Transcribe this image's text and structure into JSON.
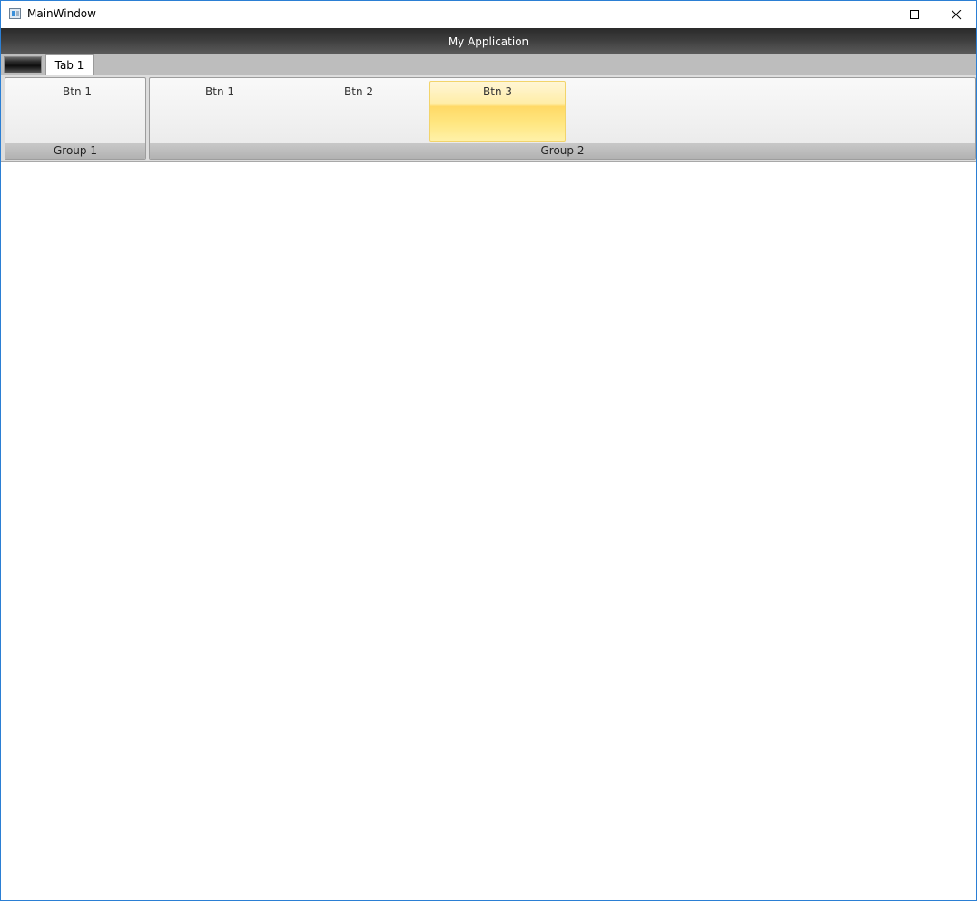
{
  "window": {
    "title": "MainWindow"
  },
  "app_header": {
    "title": "My Application"
  },
  "tabs": [
    {
      "label": "Tab 1",
      "selected": true
    }
  ],
  "ribbon": {
    "groups": [
      {
        "label": "Group 1",
        "buttons": [
          {
            "label": "Btn 1",
            "highlighted": false
          }
        ]
      },
      {
        "label": "Group 2",
        "buttons": [
          {
            "label": "Btn 1",
            "highlighted": false
          },
          {
            "label": "Btn 2",
            "highlighted": false
          },
          {
            "label": "Btn 3",
            "highlighted": true
          }
        ]
      }
    ]
  },
  "colors": {
    "window_border": "#2b7fd4",
    "header_background": "#3c3c3c",
    "hover_highlight": "#ffe680"
  },
  "icons": {
    "app": "window-app-icon",
    "minimize": "minimize-icon",
    "maximize": "maximize-icon",
    "close": "close-icon",
    "app_menu": "application-menu-button"
  }
}
